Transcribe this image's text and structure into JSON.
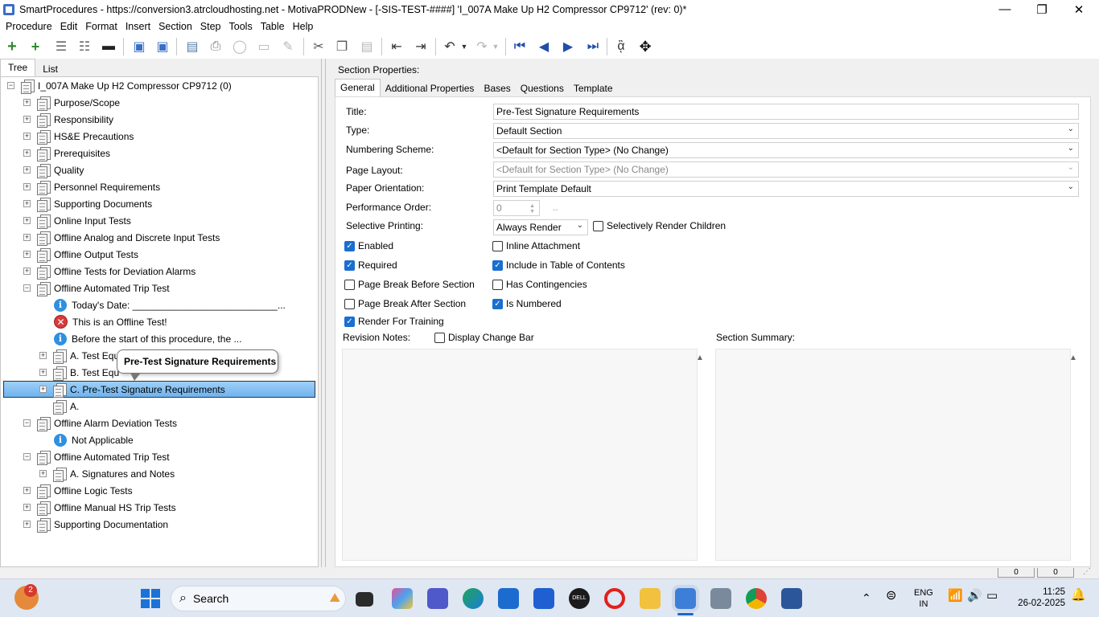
{
  "window": {
    "title": "SmartProcedures - https://conversion3.atrcloudhosting.net - MotivaPRODNew - [-SIS-TEST-####] 'I_007A Make Up H2 Compressor CP9712' (rev: 0)*",
    "minimize": "—",
    "maximize": "❐",
    "close": "✕"
  },
  "menu": [
    "Procedure",
    "Edit",
    "Format",
    "Insert",
    "Section",
    "Step",
    "Tools",
    "Table",
    "Help"
  ],
  "toolbar": {
    "icons": [
      "add-icon",
      "add-child-icon",
      "list-icon",
      "list-detail-icon",
      "remove-icon",
      "save-all-icon",
      "save-icon",
      "publish-icon",
      "print-icon",
      "refresh-icon",
      "window-icon",
      "pin-icon",
      "cut-icon",
      "copy-icon",
      "paste-icon",
      "outdent-icon",
      "indent-icon",
      "undo-icon",
      "redo-icon",
      "first-icon",
      "previous-icon",
      "next-icon",
      "last-icon",
      "spellcheck-icon",
      "move-icon"
    ]
  },
  "left_tabs": [
    "Tree",
    "List"
  ],
  "tree": {
    "root": "I_007A Make Up H2 Compressor CP9712 (0)",
    "items": [
      {
        "label": "Purpose/Scope"
      },
      {
        "label": "Responsibility"
      },
      {
        "label": "HS&E Precautions"
      },
      {
        "label": "Prerequisites"
      },
      {
        "label": "Quality"
      },
      {
        "label": "Personnel Requirements"
      },
      {
        "label": "Supporting Documents"
      },
      {
        "label": "Online Input Tests"
      },
      {
        "label": "Offline Analog and Discrete Input Tests"
      },
      {
        "label": "Offline Output Tests"
      },
      {
        "label": "Offline Tests for Deviation Alarms"
      },
      {
        "label": "Offline Automated Trip Test"
      },
      {
        "label": "Today's Date: ___________________________..."
      },
      {
        "label": "This is an Offline Test!"
      },
      {
        "label": "Before the start of this procedure, the ..."
      },
      {
        "label": "A. Test Equ"
      },
      {
        "label": "B. Test Equ"
      },
      {
        "label": "C. Pre-Test Signature Requirements"
      },
      {
        "label": "A."
      },
      {
        "label": "Offline Alarm Deviation Tests"
      },
      {
        "label": "Not Applicable"
      },
      {
        "label": "Offline Automated Trip Test"
      },
      {
        "label": "A. Signatures and Notes"
      },
      {
        "label": "Offline Logic Tests"
      },
      {
        "label": "Offline Manual HS Trip Tests"
      },
      {
        "label": "Supporting Documentation"
      }
    ],
    "tooltip": "Pre-Test Signature Requirements"
  },
  "section_properties": {
    "heading": "Section Properties:",
    "tabs": [
      "General",
      "Additional Properties",
      "Bases",
      "Questions",
      "Template"
    ],
    "fields": {
      "title_label": "Title:",
      "title_value": "Pre-Test Signature Requirements",
      "type_label": "Type:",
      "type_value": "Default Section",
      "numbering_label": "Numbering Scheme:",
      "numbering_value": "<Default for Section Type> (No Change)",
      "layout_label": "Page Layout:",
      "layout_value": "<Default for Section Type> (No Change)",
      "orientation_label": "Paper Orientation:",
      "orientation_value": "Print Template Default",
      "perf_label": "Performance Order:",
      "perf_value": "0",
      "perf_ellipsis": "..",
      "selective_label": "Selective Printing:",
      "selective_value": "Always Render"
    },
    "checkboxes": {
      "selectively_render_children": "Selectively Render Children",
      "enabled": "Enabled",
      "inline_attachment": "Inline Attachment",
      "required": "Required",
      "include_toc": "Include in Table of Contents",
      "page_break_before": "Page Break Before Section",
      "has_contingencies": "Has Contingencies",
      "page_break_after": "Page Break After Section",
      "is_numbered": "Is Numbered",
      "render_training": "Render For Training",
      "display_change_bar": "Display Change Bar"
    },
    "revision_notes_label": "Revision Notes:",
    "section_summary_label": "Section Summary:"
  },
  "status": {
    "box1": "0",
    "box2": "0"
  },
  "taskbar": {
    "notification_count": "2",
    "search_label": "Search",
    "lang_line1": "ENG",
    "lang_line2": "IN",
    "time": "11:25",
    "date": "26-02-2025"
  }
}
